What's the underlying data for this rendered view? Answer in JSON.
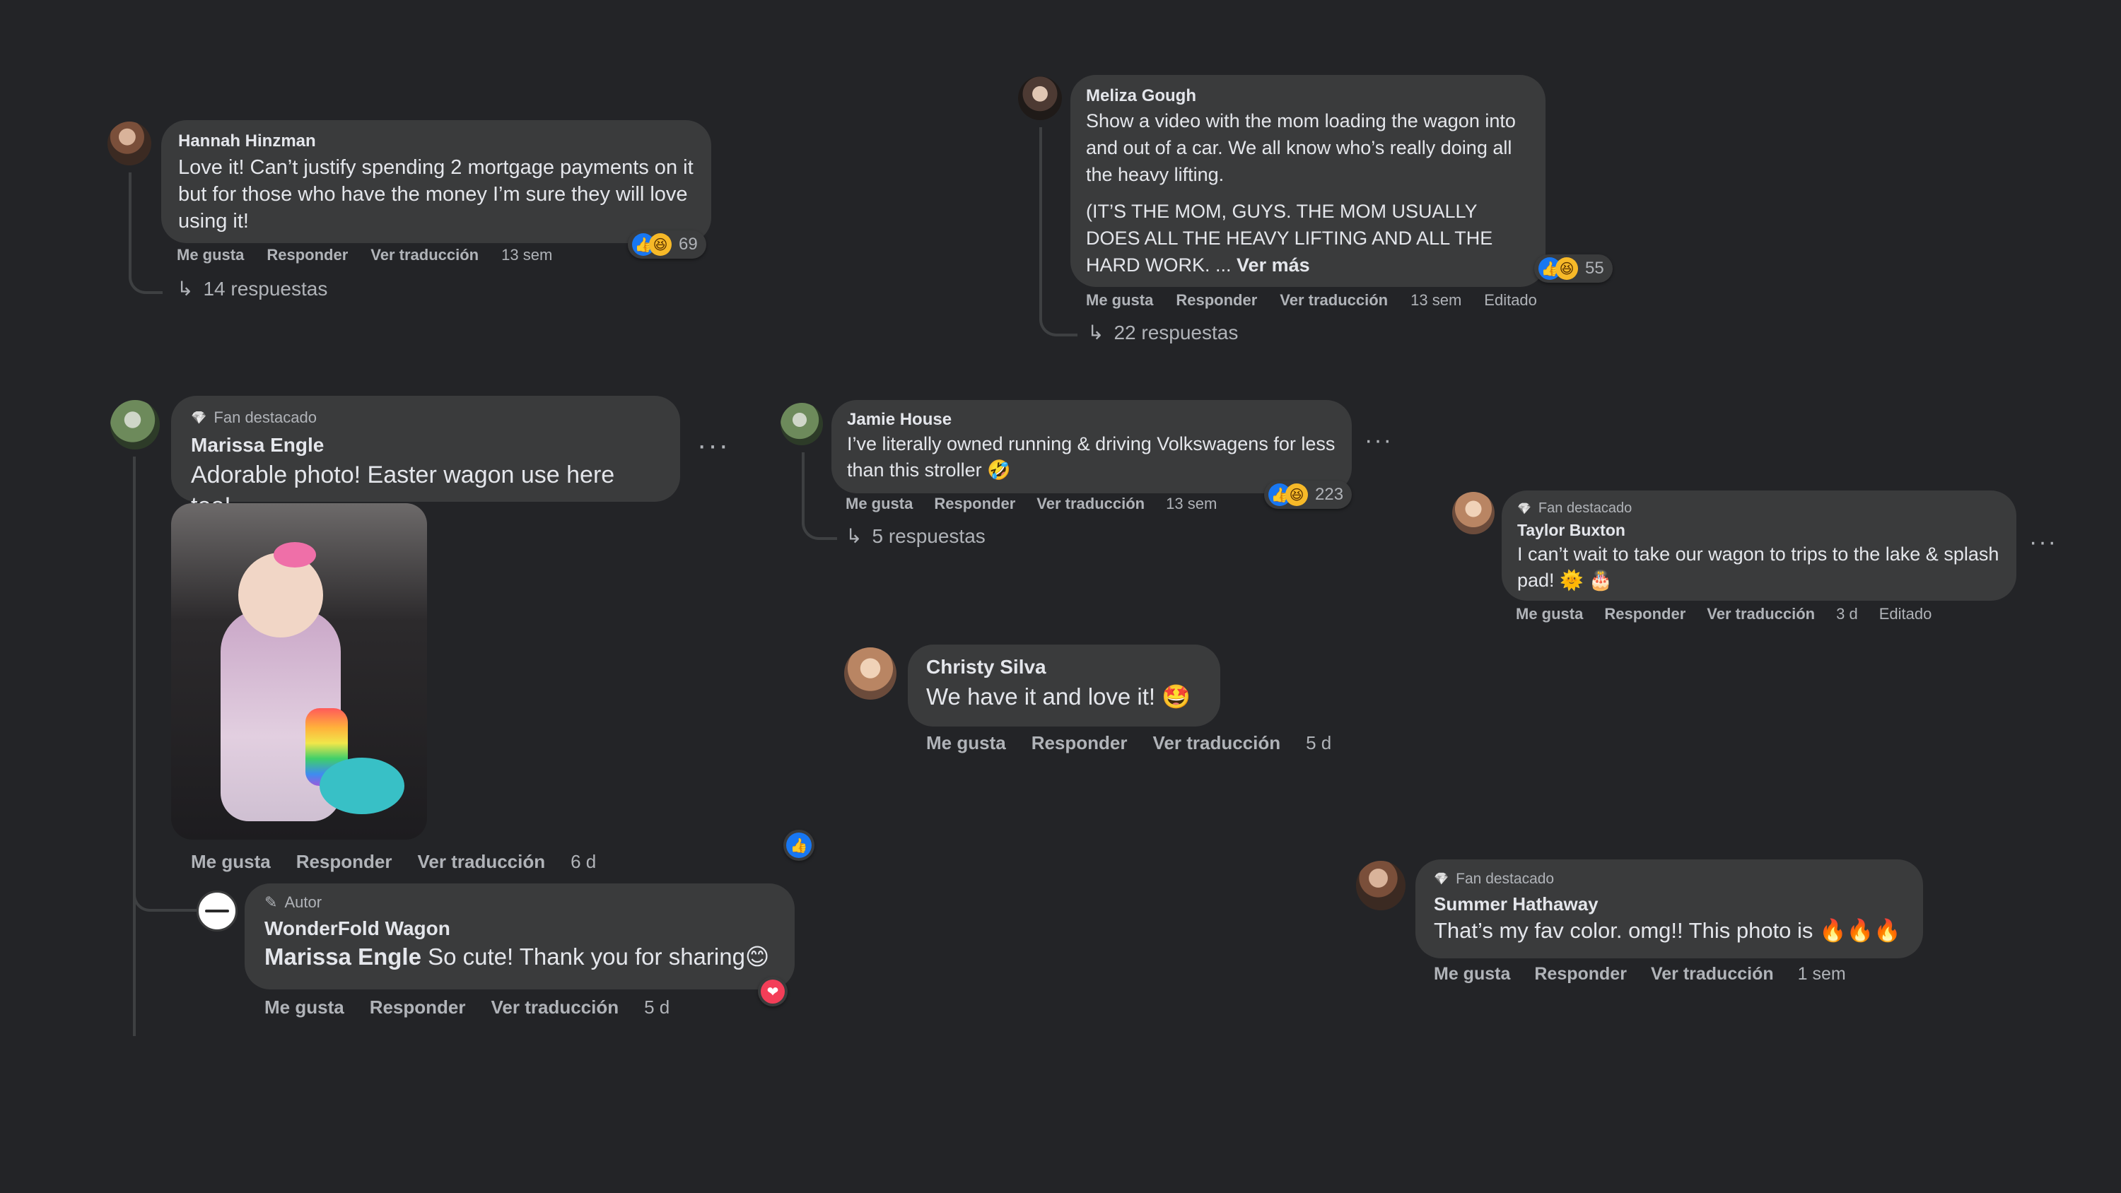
{
  "actions": {
    "like": "Me gusta",
    "reply": "Responder",
    "translate": "Ver traducción",
    "edited": "Editado"
  },
  "badges": {
    "top_fan": "Fan destacado",
    "author": "Autor"
  },
  "comments": {
    "hannah": {
      "name": "Hannah Hinzman",
      "text": "Love it! Can’t justify spending 2 mortgage payments on it but for those who have the money I’m sure they will love using it!",
      "time": "13 sem",
      "reaction_count": "69",
      "replies": "14 respuestas"
    },
    "meliza": {
      "name": "Meliza Gough",
      "text_p1": "Show a video with the mom loading the wagon into and out of a car. We all know who’s really doing all the heavy lifting.",
      "text_p2": "(IT’S THE MOM, GUYS. THE MOM USUALLY DOES ALL THE HEAVY LIFTING AND ALL THE HARD WORK. ...",
      "see_more": "Ver más",
      "time": "13 sem",
      "reaction_count": "55",
      "replies": "22 respuestas"
    },
    "marissa": {
      "name": "Marissa Engle",
      "text": "Adorable photo! Easter wagon use here too!",
      "time": "6 d"
    },
    "wonderfold": {
      "name": "WonderFold Wagon",
      "mention": "Marissa Engle",
      "text": "So cute! Thank you for sharing😊",
      "time": "5 d"
    },
    "jamie": {
      "name": "Jamie House",
      "text": "I’ve literally owned running & driving Volkswagens for less than this stroller 🤣",
      "time": "13 sem",
      "reaction_count": "223",
      "replies": "5 respuestas"
    },
    "taylor": {
      "name": "Taylor Buxton",
      "text": "I can’t wait to take our wagon to trips to the lake & splash pad! 🌞 🎂",
      "time": "3 d"
    },
    "christy": {
      "name": "Christy Silva",
      "text": "We have it and love it! 🤩",
      "time": "5 d"
    },
    "summer": {
      "name": "Summer Hathaway",
      "text": "That’s my fav color. omg!! This photo is 🔥🔥🔥",
      "time": "1 sem"
    }
  },
  "icons": {
    "like": "👍",
    "haha": "😆",
    "heart": "❤",
    "reply_arrow": "↳",
    "more": "···",
    "diamond": "💎",
    "pencil": "✎"
  },
  "colors": {
    "background": "#232427",
    "bubble": "#3a3b3c",
    "text": "#e4e6eb",
    "secondary": "#b0b3b8",
    "like_blue": "#1877f2",
    "heart_red": "#f33e58"
  }
}
